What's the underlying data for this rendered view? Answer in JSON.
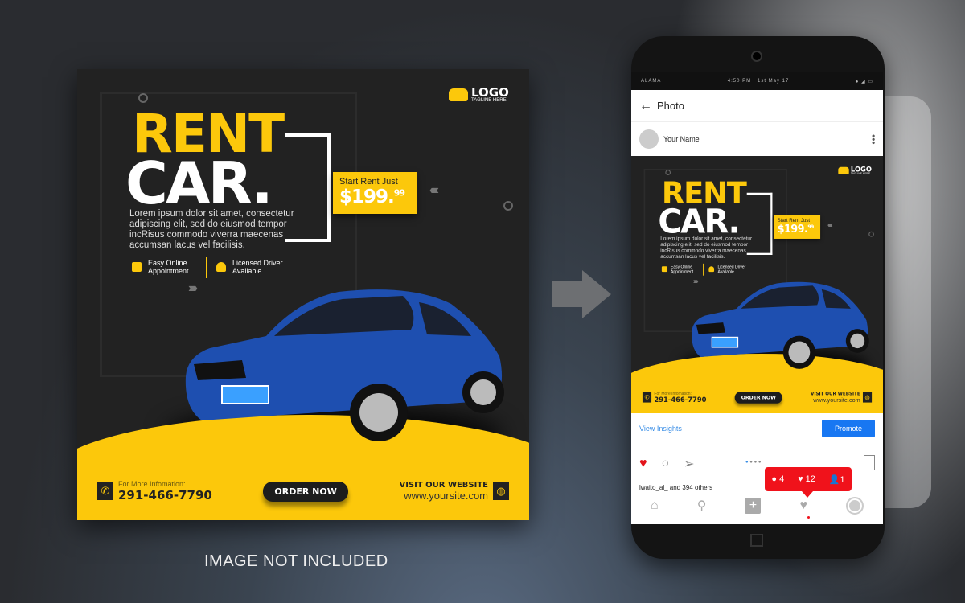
{
  "poster": {
    "logo": "LOGO",
    "tagline": "TAGLINE HERE",
    "title_line1": "RENT",
    "title_line2": "CAR.",
    "price_label": "Start Rent Just",
    "price_main": "$199.",
    "price_cents": "99",
    "description": "Lorem ipsum dolor sit amet, consectetur adipiscing elit, sed do eiusmod tempor incRisus commodo viverra maecenas accumsan lacus vel facilisis.",
    "features": [
      "Easy Online Appointment",
      "Licensed Driver Available"
    ],
    "contact_label": "For More Infomation:",
    "phone": "291-466-7790",
    "order_button": "ORDER NOW",
    "website_label": "VISIT OUR WEBSITE",
    "website": "www.yoursite.com",
    "colors": {
      "accent": "#fcc80b",
      "background": "#222222",
      "car": "#1e4fb0"
    }
  },
  "caption": "IMAGE NOT INCLUDED",
  "phone": {
    "carrier": "ALAMA",
    "time": "4:50 PM | 1st May 17",
    "header_title": "Photo",
    "user_name": "Your Name",
    "view_insights": "View Insights",
    "promote": "Promote",
    "notification": {
      "comments": "4",
      "likes": "12",
      "followers": "1"
    },
    "liked_by": "lwaito_al_ and 394 others",
    "colors": {
      "like": "#e3141b",
      "promote": "#1877f2",
      "notification": "#f0121b"
    }
  }
}
